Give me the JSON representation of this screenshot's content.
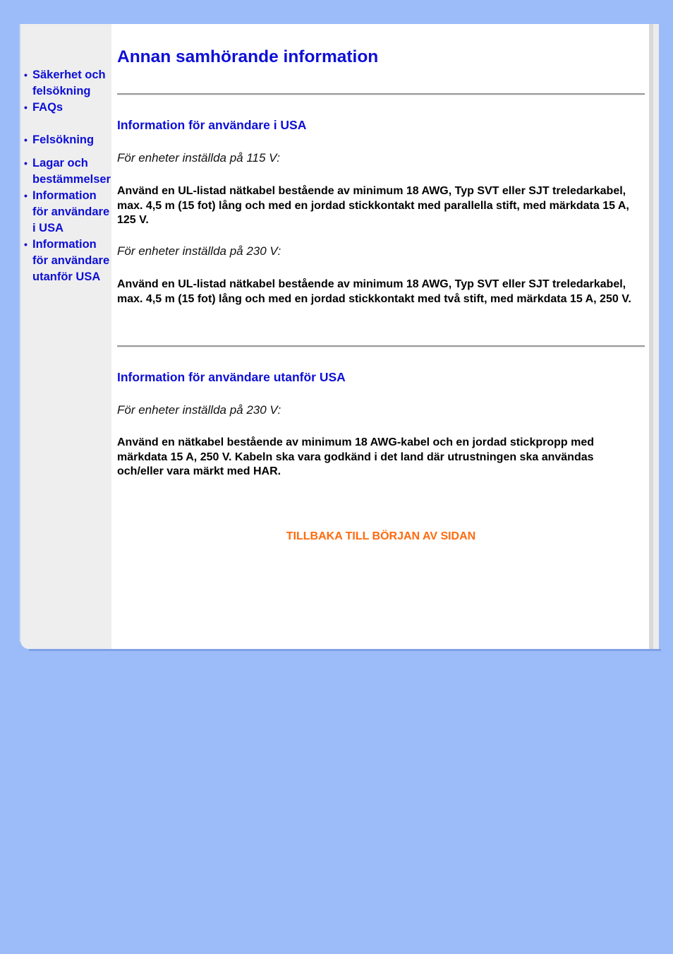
{
  "sidebar": {
    "items": [
      {
        "label": "Säkerhet och felsökning"
      },
      {
        "label": "FAQs"
      },
      {
        "label": "Felsökning"
      },
      {
        "label": "Lagar och bestämmelser"
      },
      {
        "label": "Information för användare i USA"
      },
      {
        "label": "Information för användare utanför USA"
      }
    ],
    "bullet": "•"
  },
  "main": {
    "title": "Annan samhörande information",
    "sections": [
      {
        "title": "Information för användare i USA",
        "blocks": [
          {
            "voltage_label": "För enheter inställda på 115 V:",
            "text": "Använd en UL-listad nätkabel bestående av minimum 18 AWG, Typ SVT eller SJT treledarkabel, max. 4,5 m (15 fot) lång och med en jordad stickkontakt med parallella stift, med märkdata 15 A, 125 V."
          },
          {
            "voltage_label": "För enheter inställda på 230 V:",
            "text": "Använd en UL-listad nätkabel bestående av minimum 18 AWG, Typ SVT eller SJT treledarkabel, max. 4,5 m (15 fot) lång och med en jordad stickkontakt med två stift, med märkdata 15 A, 250 V."
          }
        ]
      },
      {
        "title": "Information för användare utanför USA",
        "blocks": [
          {
            "voltage_label": "För enheter inställda på 230 V:",
            "text": "Använd en nätkabel bestående av minimum 18 AWG-kabel och en jordad stickpropp med märkdata 15 A, 250 V. Kabeln ska vara godkänd i det land där utrustningen ska användas och/eller vara märkt med HAR."
          }
        ]
      }
    ],
    "back_to_top": "TILLBAKA TILL BÖRJAN AV SIDAN"
  },
  "colors": {
    "background": "#9bbcf8",
    "link": "#0d0fd6",
    "back_link": "#ff6a0d",
    "sidebar_bg": "#eeeeee"
  }
}
